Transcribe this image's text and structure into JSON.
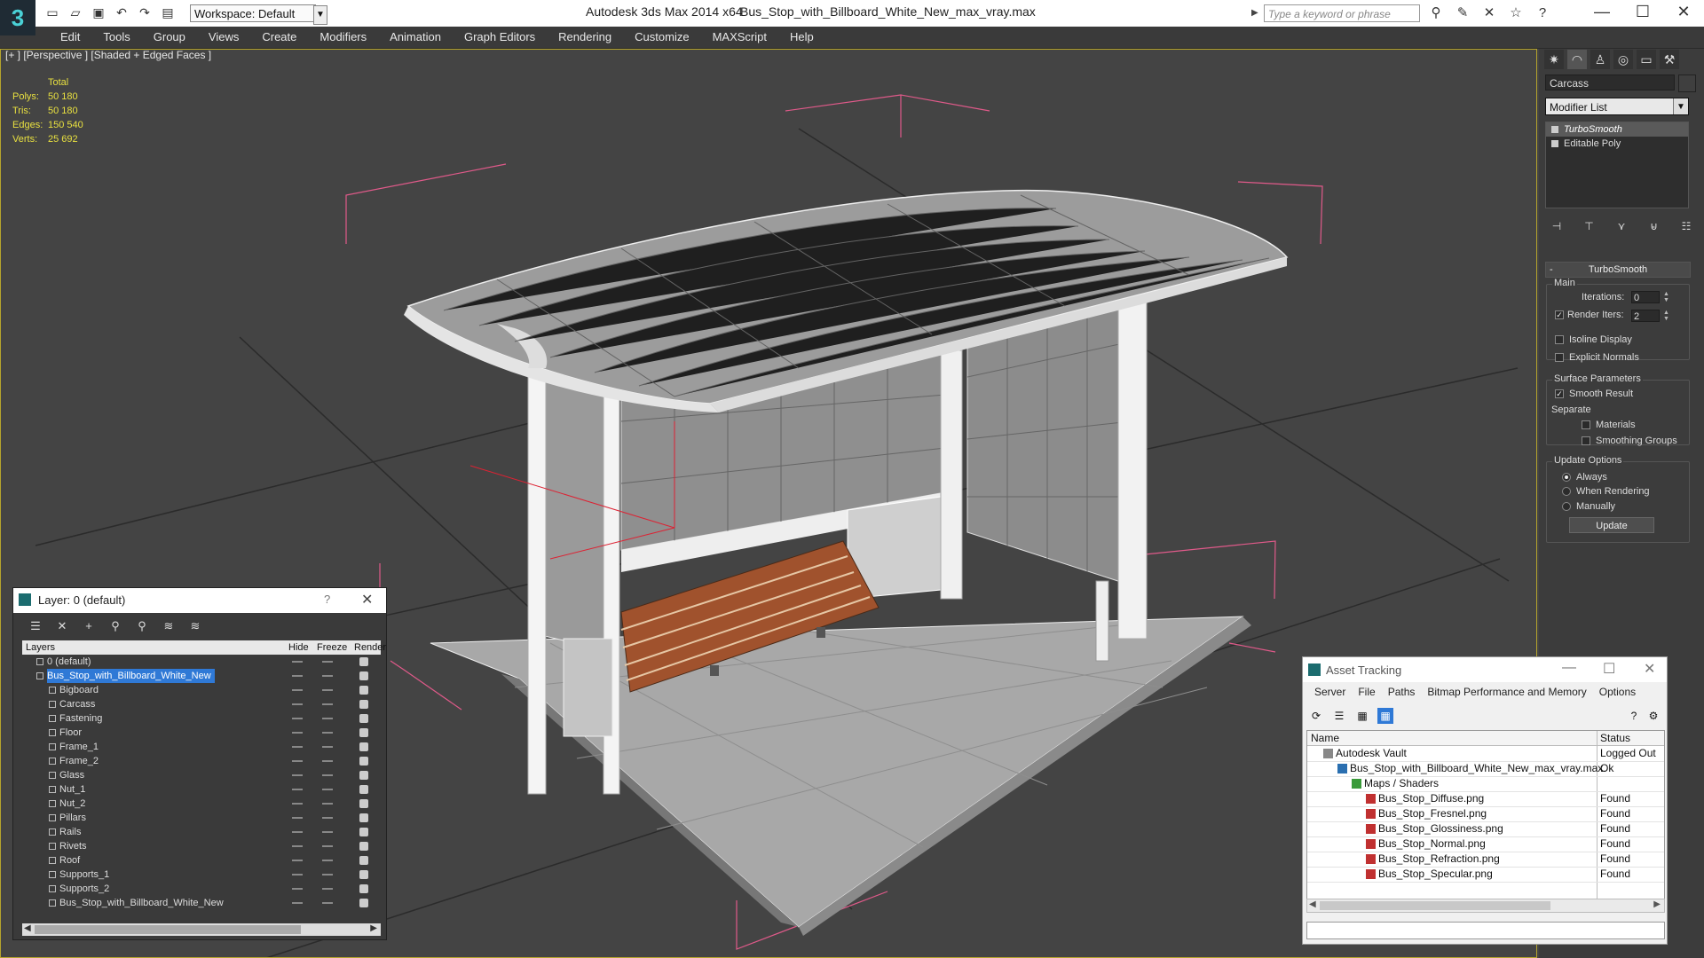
{
  "window": {
    "app_title": "Autodesk 3ds Max  2014 x64",
    "file_title": "Bus_Stop_with_Billboard_White_New_max_vray.max",
    "workspace": "Workspace: Default",
    "search_placeholder": "Type a keyword or phrase"
  },
  "menu": [
    "Edit",
    "Tools",
    "Group",
    "Views",
    "Create",
    "Modifiers",
    "Animation",
    "Graph Editors",
    "Rendering",
    "Customize",
    "MAXScript",
    "Help"
  ],
  "viewport": {
    "label": "[+ ] [Perspective ] [Shaded + Edged Faces ]",
    "stats_header": "Total",
    "stats": [
      {
        "k": "Polys:",
        "v": "50 180"
      },
      {
        "k": "Tris:",
        "v": "50 180"
      },
      {
        "k": "Edges:",
        "v": "150 540"
      },
      {
        "k": "Verts:",
        "v": "25 692"
      }
    ]
  },
  "command_panel": {
    "object_name": "Carcass",
    "modifier_list": "Modifier List",
    "stack": [
      "TurboSmooth",
      "Editable Poly"
    ],
    "rollout_title": "TurboSmooth",
    "main_label": "Main",
    "iterations_label": "Iterations:",
    "iterations_value": "0",
    "render_iters_label": "Render Iters:",
    "render_iters_value": "2",
    "isoline": "Isoline Display",
    "explicit_normals": "Explicit Normals",
    "surface_params": "Surface Parameters",
    "smooth_result": "Smooth Result",
    "separate": "Separate",
    "materials": "Materials",
    "smoothing_groups": "Smoothing Groups",
    "update_options": "Update Options",
    "always": "Always",
    "when_rendering": "When Rendering",
    "manually": "Manually",
    "update_button": "Update"
  },
  "layer_window": {
    "title": "Layer: 0 (default)",
    "help": "?",
    "columns": {
      "layers": "Layers",
      "hide": "Hide",
      "freeze": "Freeze",
      "render": "Render"
    },
    "rows": [
      {
        "name": "0 (default)",
        "indent": 0
      },
      {
        "name": "Bus_Stop_with_Billboard_White_New",
        "indent": 0,
        "selected": true
      },
      {
        "name": "Bigboard",
        "indent": 1
      },
      {
        "name": "Carcass",
        "indent": 1
      },
      {
        "name": "Fastening",
        "indent": 1
      },
      {
        "name": "Floor",
        "indent": 1
      },
      {
        "name": "Frame_1",
        "indent": 1
      },
      {
        "name": "Frame_2",
        "indent": 1
      },
      {
        "name": "Glass",
        "indent": 1
      },
      {
        "name": "Nut_1",
        "indent": 1
      },
      {
        "name": "Nut_2",
        "indent": 1
      },
      {
        "name": "Pillars",
        "indent": 1
      },
      {
        "name": "Rails",
        "indent": 1
      },
      {
        "name": "Rivets",
        "indent": 1
      },
      {
        "name": "Roof",
        "indent": 1
      },
      {
        "name": "Supports_1",
        "indent": 1
      },
      {
        "name": "Supports_2",
        "indent": 1
      },
      {
        "name": "Bus_Stop_with_Billboard_White_New",
        "indent": 1
      }
    ]
  },
  "asset_tracking": {
    "title": "Asset Tracking",
    "menu": [
      "Server",
      "File",
      "Paths",
      "Bitmap Performance and Memory",
      "Options"
    ],
    "columns": {
      "name": "Name",
      "status": "Status"
    },
    "rows": [
      {
        "name": "Autodesk Vault",
        "status": "Logged Out ..",
        "level": 0,
        "icon": "vault"
      },
      {
        "name": "Bus_Stop_with_Billboard_White_New_max_vray.max",
        "status": "Ok",
        "level": 1,
        "icon": "max"
      },
      {
        "name": "Maps / Shaders",
        "status": "",
        "level": 2,
        "icon": "maps"
      },
      {
        "name": "Bus_Stop_Diffuse.png",
        "status": "Found",
        "level": 3,
        "icon": "png"
      },
      {
        "name": "Bus_Stop_Fresnel.png",
        "status": "Found",
        "level": 3,
        "icon": "png"
      },
      {
        "name": "Bus_Stop_Glossiness.png",
        "status": "Found",
        "level": 3,
        "icon": "png"
      },
      {
        "name": "Bus_Stop_Normal.png",
        "status": "Found",
        "level": 3,
        "icon": "png"
      },
      {
        "name": "Bus_Stop_Refraction.png",
        "status": "Found",
        "level": 3,
        "icon": "png"
      },
      {
        "name": "Bus_Stop_Specular.png",
        "status": "Found",
        "level": 3,
        "icon": "png"
      }
    ]
  },
  "colors": {
    "viewport_bg": "#444444",
    "selection_blue": "#2f79d6",
    "stats_yellow": "#e8e040",
    "bench_wood": "#a0522d",
    "bbox_pink": "#e05a8a"
  }
}
